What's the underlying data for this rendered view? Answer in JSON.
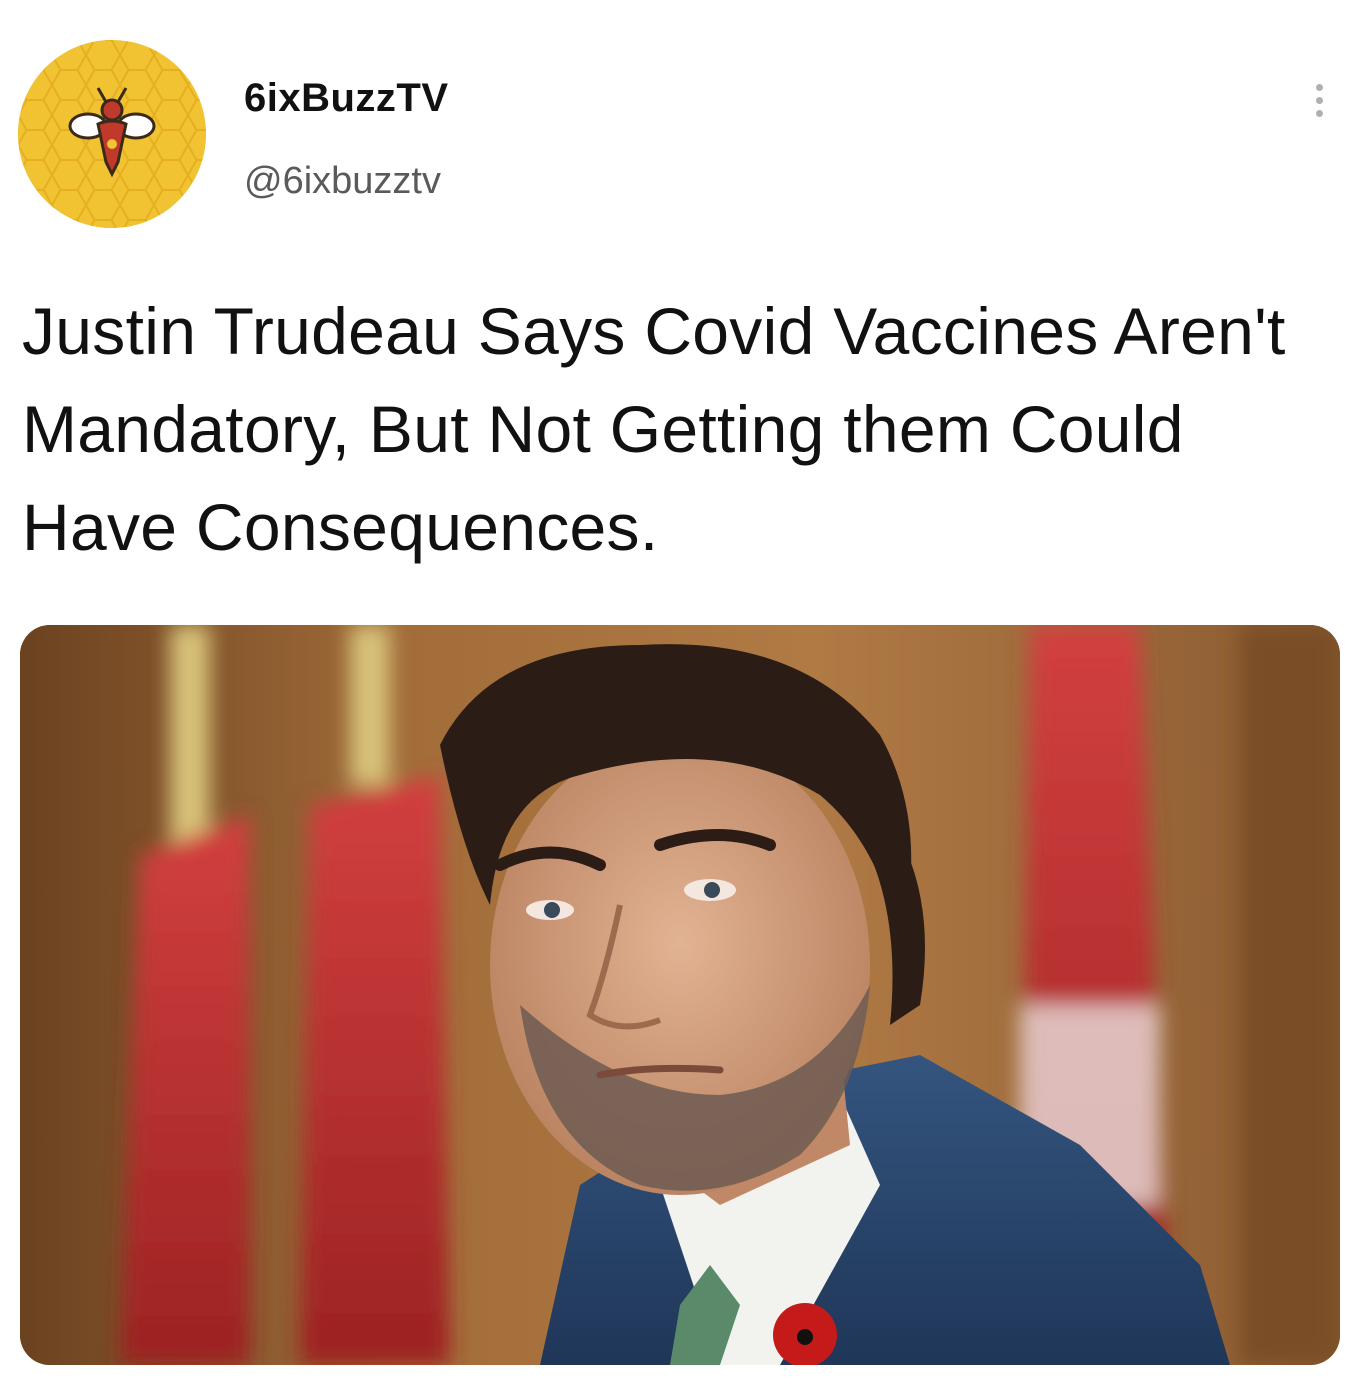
{
  "tweet": {
    "author": {
      "display_name": "6ixBuzzTV",
      "handle": "@6ixbuzztv",
      "avatar": "bee-logo-icon"
    },
    "more_icon": "more-options-icon",
    "text": "Justin Trudeau Says Covid Vaccines Aren't Mandatory, But Not Getting them Could Have Consequences.",
    "media": {
      "type": "photo"
    }
  },
  "colors": {
    "avatar_bg": "#f1c232",
    "text": "#111111",
    "handle": "#5a5a5a"
  }
}
